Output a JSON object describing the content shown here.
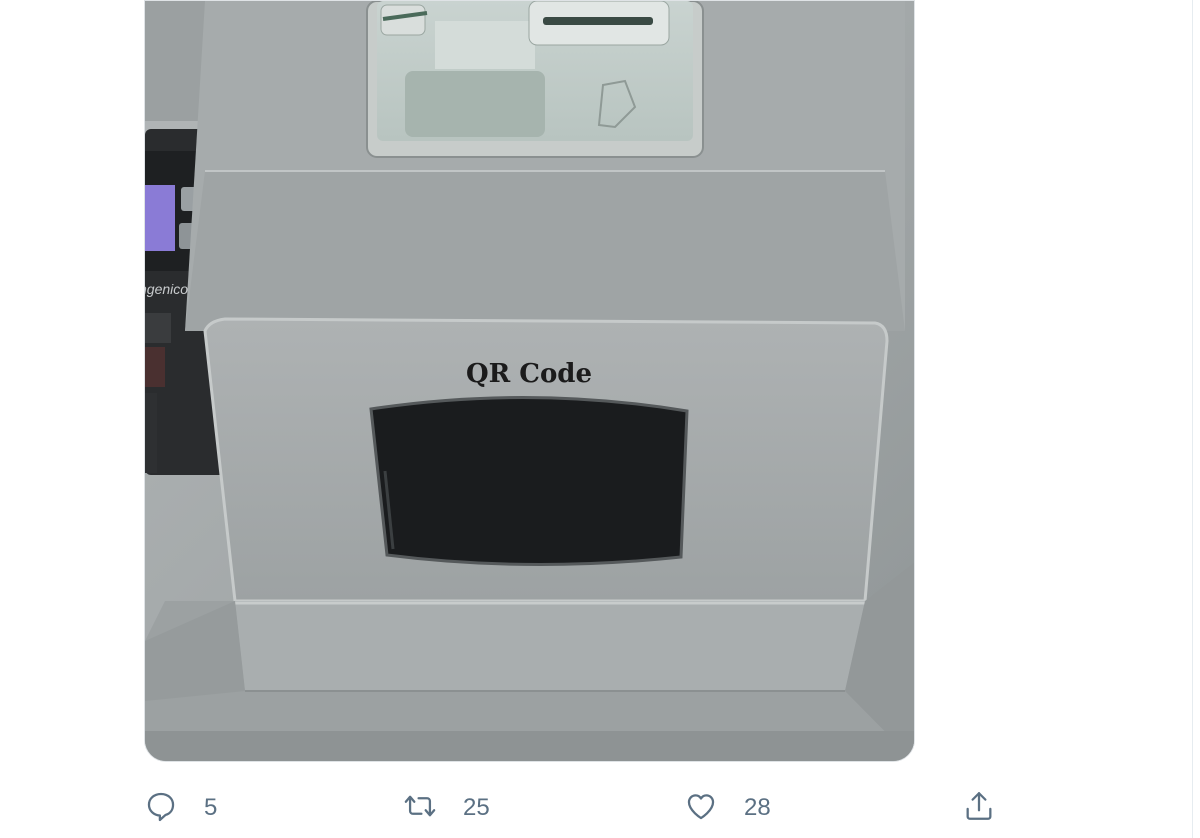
{
  "tweet": {
    "media": {
      "label_text": "QR Code",
      "brand_text": "ngenico"
    },
    "actions": {
      "reply": {
        "icon": "reply-icon",
        "count": "5"
      },
      "retweet": {
        "icon": "retweet-icon",
        "count": "25"
      },
      "like": {
        "icon": "heart-icon",
        "count": "28"
      },
      "share": {
        "icon": "share-icon"
      }
    }
  },
  "colors": {
    "icon_gray": "#5b7083",
    "panel_gray": "#a7acad",
    "screen_black": "#1a1c1e",
    "background": "#ffffff"
  }
}
